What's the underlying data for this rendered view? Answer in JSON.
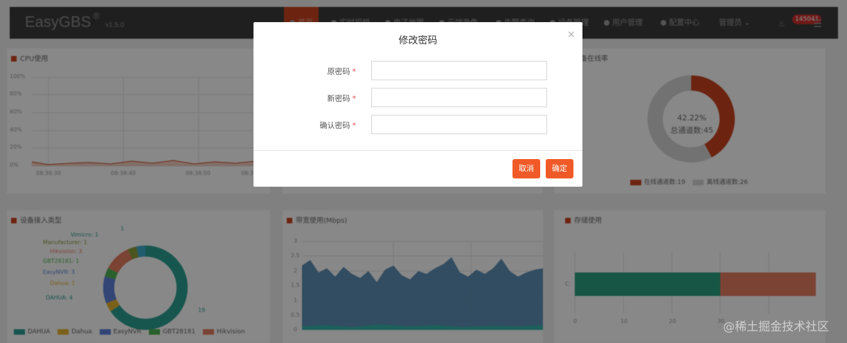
{
  "app": {
    "brand": "EasyGBS",
    "brand_mark": "®",
    "version": "v1.5.0",
    "nav": [
      {
        "label": "首页",
        "active": true
      },
      {
        "label": "实时视频",
        "active": false
      },
      {
        "label": "电子地图",
        "active": false
      },
      {
        "label": "云端录像",
        "active": false
      },
      {
        "label": "告警查询",
        "active": false
      },
      {
        "label": "设备管理",
        "active": false
      },
      {
        "label": "用户管理",
        "active": false
      },
      {
        "label": "配置中心",
        "active": false
      }
    ],
    "user_menu": "管理员",
    "notification_count": "145041"
  },
  "panels": {
    "cpu": {
      "title": "CPU使用",
      "y_ticks": [
        "100%",
        "80%",
        "60%",
        "40%",
        "20%",
        "0%"
      ],
      "x_ticks": [
        "08:38:30",
        "08:38:40",
        "08:38:50",
        "08:3"
      ]
    },
    "online": {
      "title": "设备在线率",
      "percent_label": "42.22%",
      "total_label": "总通道数:45",
      "legend": [
        "在线通道数:19",
        "离线通道数:26"
      ]
    },
    "access": {
      "title": "设备接入类型",
      "labels": [
        "Vimicro: 1",
        "Manufacturer: 1",
        "Hikvision: 3",
        "GBT28181: 1",
        "EasyNVR: 3",
        "Dahua: 1",
        "DAHUA: 4"
      ],
      "callout_top": "1",
      "callout_bottom": "19",
      "legend": [
        "DAHUA",
        "Dahua",
        "EasyNVR",
        "GBT28181",
        "Hikvision"
      ]
    },
    "bandwidth": {
      "title": "带宽使用(Mbps)",
      "y_ticks": [
        "3",
        "2.5",
        "2",
        "1.5",
        "1",
        "0.5",
        "0"
      ]
    },
    "storage": {
      "title": "存储使用",
      "category": "C:",
      "x_ticks": [
        "0",
        "10",
        "20",
        "30"
      ]
    }
  },
  "colors": {
    "accent": "#f05a28",
    "topbar": "#3a3a3a",
    "online": "#c5431f",
    "offline": "#cfcfcf",
    "teal": "#2a9d8f",
    "bandwidth_fill": "#4a7fa8",
    "storage_used": "#2a9d7c",
    "storage_free": "#e07a5f"
  },
  "chart_data": [
    {
      "type": "pie",
      "title": "设备在线率",
      "categories": [
        "在线通道数",
        "离线通道数"
      ],
      "values": [
        19,
        26
      ]
    },
    {
      "type": "pie",
      "title": "设备接入类型",
      "categories": [
        "DAHUA",
        "Dahua",
        "EasyNVR",
        "GBT28181",
        "Hikvision",
        "Manufacturer",
        "Vimicro"
      ],
      "values": [
        19,
        1,
        3,
        1,
        3,
        1,
        1
      ]
    },
    {
      "type": "bar",
      "title": "存储使用",
      "categories": [
        "C:"
      ],
      "series": [
        {
          "values": [
            30
          ]
        },
        {
          "values": [
            20
          ]
        }
      ],
      "xlim": [
        0,
        50
      ]
    }
  ],
  "modal": {
    "title": "修改密码",
    "close": "×",
    "fields": [
      {
        "label": "原密码",
        "required_mark": "*",
        "value": ""
      },
      {
        "label": "新密码",
        "required_mark": "*",
        "value": ""
      },
      {
        "label": "确认密码",
        "required_mark": "*",
        "value": ""
      }
    ],
    "cancel": "取消",
    "confirm": "确定"
  },
  "watermark": "@稀土掘金技术社区"
}
